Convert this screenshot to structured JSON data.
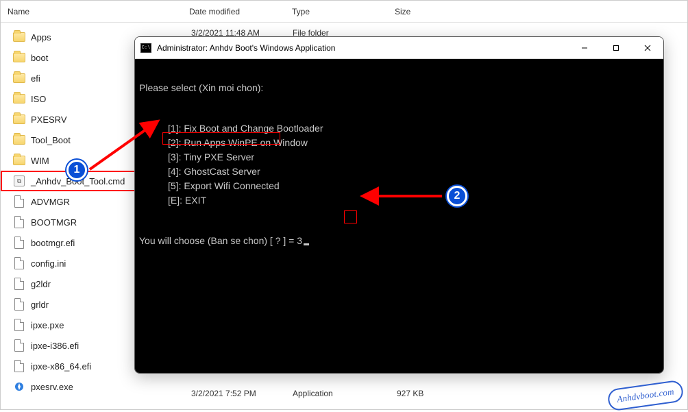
{
  "explorer": {
    "columns": {
      "name": "Name",
      "date": "Date modified",
      "type": "Type",
      "size": "Size"
    },
    "truncated_row": {
      "date": "3/2/2021 11:48 AM",
      "type": "File folder"
    },
    "items": [
      {
        "name": "Apps",
        "kind": "folder"
      },
      {
        "name": "boot",
        "kind": "folder"
      },
      {
        "name": "efi",
        "kind": "folder"
      },
      {
        "name": "ISO",
        "kind": "folder"
      },
      {
        "name": "PXESRV",
        "kind": "folder"
      },
      {
        "name": "Tool_Boot",
        "kind": "folder"
      },
      {
        "name": "WIM",
        "kind": "folder"
      },
      {
        "name": "_Anhdv_Boot_Tool.cmd",
        "kind": "cmd",
        "selected": true
      },
      {
        "name": "ADVMGR",
        "kind": "file"
      },
      {
        "name": "BOOTMGR",
        "kind": "file"
      },
      {
        "name": "bootmgr.efi",
        "kind": "file"
      },
      {
        "name": "config.ini",
        "kind": "file"
      },
      {
        "name": "g2ldr",
        "kind": "file"
      },
      {
        "name": "grldr",
        "kind": "file"
      },
      {
        "name": "ipxe.pxe",
        "kind": "file"
      },
      {
        "name": "ipxe-i386.efi",
        "kind": "file"
      },
      {
        "name": "ipxe-x86_64.efi",
        "kind": "file"
      },
      {
        "name": "pxesrv.exe",
        "kind": "exe"
      }
    ],
    "detail": {
      "date": "3/2/2021 7:52 PM",
      "type": "Application",
      "size": "927 KB"
    }
  },
  "console": {
    "title": "Administrator:  Anhdv Boot's Windows Application",
    "prompt_header": "Please select (Xin moi chon):",
    "menu": [
      "[1]: Fix Boot and Change Bootloader",
      "[2]: Run Apps WinPE on Window",
      "[3]: Tiny PXE Server",
      "[4]: GhostCast Server",
      "[5]: Export Wifi Connected",
      "[E]: EXIT"
    ],
    "choose_line_prefix": "You will choose (Ban se chon) [ ? ] = ",
    "choose_value": "3"
  },
  "markers": {
    "one": "1",
    "two": "2"
  },
  "watermark": "Anhdvboot.com"
}
